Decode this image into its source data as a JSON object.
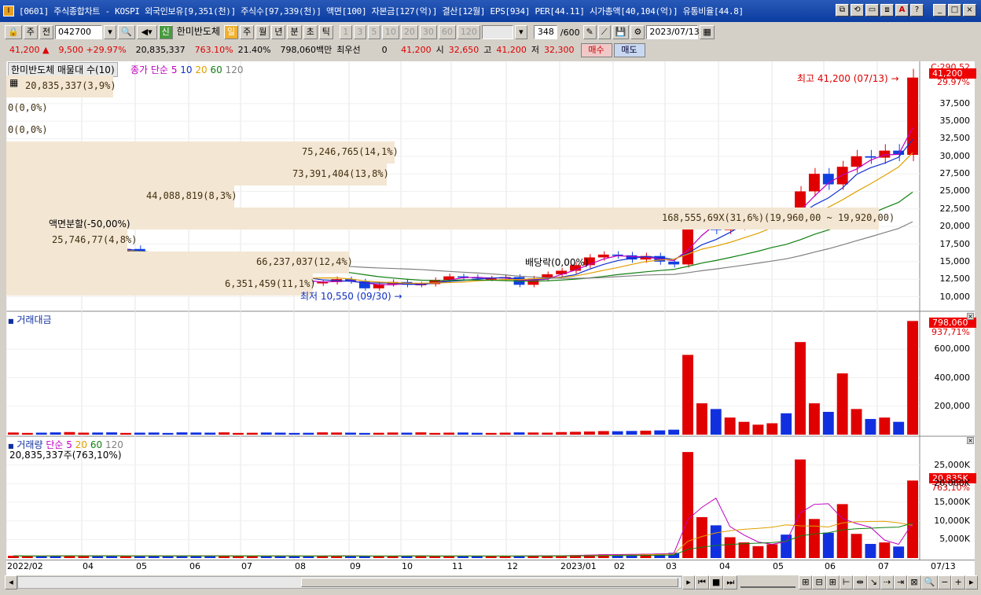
{
  "title": {
    "text": "[0601] 주식종합차트 - KOSPI 외국인보유[9,351(천)] 주식수[97,339(천)] 액면[100] 자본금[127(억)] 결산[12월] EPS[934] PER[44.11] 시가총액[40,104(억)] 유통비율[44.8]",
    "icon": "I",
    "buttons": [
      "⧉",
      "⟲",
      "▭",
      "⧈",
      "A",
      "?",
      "_",
      "□",
      "×"
    ]
  },
  "toolbar": {
    "kind": "주",
    "prev": "전",
    "code": "042700",
    "stock_name": "한미반도체",
    "new_badge": "신",
    "periods": [
      "일",
      "주",
      "월",
      "년",
      "분",
      "초",
      "틱"
    ],
    "selected_period": "일",
    "intervals": [
      "1",
      "3",
      "5",
      "10",
      "20",
      "30",
      "60",
      "120"
    ],
    "count": "348",
    "count_total": "/600",
    "date": "2023/07/13"
  },
  "quote": {
    "price": "41,200",
    "change": "9,500",
    "change_pct": "+29.97%",
    "volume": "20,835,337",
    "volume_ratio": "763.10%",
    "turnover": "21.40%",
    "amount": "798,060백만",
    "priority_label": "최우선",
    "priority_value": "0",
    "ask": "41,200",
    "open_label": "시",
    "open": "32,650",
    "high_label": "고",
    "high": "41,200",
    "low_label": "저",
    "low": "32,300",
    "buy": "매수",
    "sell": "매도"
  },
  "price_panel": {
    "title": "한미반도체 매물대 수(10)",
    "ma_label": "종가 단순",
    "ma_periods": [
      "5",
      "10",
      "20",
      "60",
      "120"
    ],
    "ma_colors": [
      "#c000c0",
      "#1030d0",
      "#e0a000",
      "#108010",
      "#808080"
    ],
    "top_label": "C:290.52",
    "price_tag": "41,200",
    "pct_tag": "29.97%",
    "yticks": [
      "37,500",
      "35,000",
      "32,500",
      "30,000",
      "27,500",
      "25,000",
      "22,500",
      "20,000",
      "17,500",
      "15,000",
      "12,500",
      "10,000"
    ],
    "bands": [
      {
        "text": "20,835,337(3,9%)"
      },
      {
        "text": "0(0,0%)"
      },
      {
        "text": "0(0,0%)"
      },
      {
        "text": "75,246,765(14,1%)"
      },
      {
        "text": "73,391,404(13,8%)"
      },
      {
        "text": "44,088,819(8,3%)"
      },
      {
        "text": "168,555,69X(31,6%)(19,960,00 ~ 19,920,00)"
      },
      {
        "text": "25,746,77(4,8%)"
      },
      {
        "text": "66,237,037(12,4%)"
      },
      {
        "text": "6,351,459(11,1%)"
      }
    ],
    "annotations": {
      "high": "최고 41,200 (07/13) →",
      "low": "최저 10,550 (09/30) →",
      "split": "액면분할(-50,00%)",
      "dividend": "배당락(0,00%)"
    }
  },
  "amount_panel": {
    "title": "거래대금",
    "tag": "798,060",
    "tag_pct": "937,71%",
    "yticks": [
      "600,000",
      "400,000",
      "200,000"
    ]
  },
  "volume_panel": {
    "title": "거래량",
    "ma_label": "단순",
    "ma_periods": [
      "5",
      "20",
      "60",
      "120"
    ],
    "value": "20,835,337주(763,10%)",
    "tag": "20,835K",
    "tag_pct": "763,10%",
    "yticks": [
      "25,000K",
      "20,000K",
      "15,000K",
      "10,000K",
      "5,000K"
    ]
  },
  "xaxis": {
    "labels": [
      "2022/02",
      "04",
      "05",
      "06",
      "07",
      "08",
      "09",
      "10",
      "11",
      "12",
      "2023/01",
      "02",
      "03",
      "04",
      "05",
      "06",
      "07"
    ],
    "right_label": "07/13"
  },
  "series": {
    "close": [
      16.5,
      16.8,
      16.2,
      15.8,
      16.5,
      17.2,
      17.0,
      16.4,
      16.8,
      15.5,
      14.8,
      14.2,
      13.8,
      12.2,
      11.8,
      12.4,
      13.4,
      13.6,
      13.0,
      12.7,
      12.3,
      11.9,
      12.1,
      12.5,
      12.2,
      11.2,
      11.8,
      12.1,
      11.7,
      11.8,
      12.4,
      12.9,
      12.8,
      12.6,
      12.6,
      12.8,
      11.7,
      12.6,
      13.2,
      13.7,
      14.5,
      15.6,
      16.0,
      15.9,
      15.3,
      15.8,
      15.0,
      14.6,
      20.3,
      21.3,
      19.5,
      20.1,
      20.5,
      21.0,
      21.4,
      20.4,
      25.0,
      27.5,
      26.0,
      28.5,
      30.0,
      29.8,
      30.8,
      30.2,
      41.2
    ],
    "amount": [
      15,
      12,
      14,
      16,
      18,
      14,
      15,
      16,
      12,
      14,
      15,
      12,
      16,
      15,
      14,
      16,
      12,
      13,
      15,
      14,
      12,
      13,
      16,
      15,
      14,
      12,
      13,
      15,
      14,
      16,
      12,
      14,
      15,
      13,
      12,
      14,
      16,
      15,
      14,
      18,
      20,
      22,
      25,
      24,
      26,
      28,
      30,
      35,
      560,
      220,
      180,
      120,
      90,
      70,
      80,
      150,
      650,
      220,
      160,
      430,
      180,
      110,
      120,
      90,
      798
    ],
    "volume": [
      600,
      500,
      550,
      650,
      700,
      550,
      600,
      620,
      500,
      560,
      600,
      500,
      650,
      600,
      560,
      640,
      500,
      520,
      600,
      560,
      480,
      520,
      640,
      600,
      560,
      480,
      520,
      600,
      560,
      640,
      480,
      560,
      600,
      520,
      480,
      560,
      640,
      600,
      560,
      720,
      800,
      880,
      1000,
      960,
      1040,
      1120,
      1200,
      1400,
      28500,
      11000,
      8800,
      5600,
      4200,
      3200,
      3700,
      6300,
      26500,
      10500,
      6800,
      14500,
      6500,
      3800,
      4200,
      3100,
      20835
    ]
  }
}
